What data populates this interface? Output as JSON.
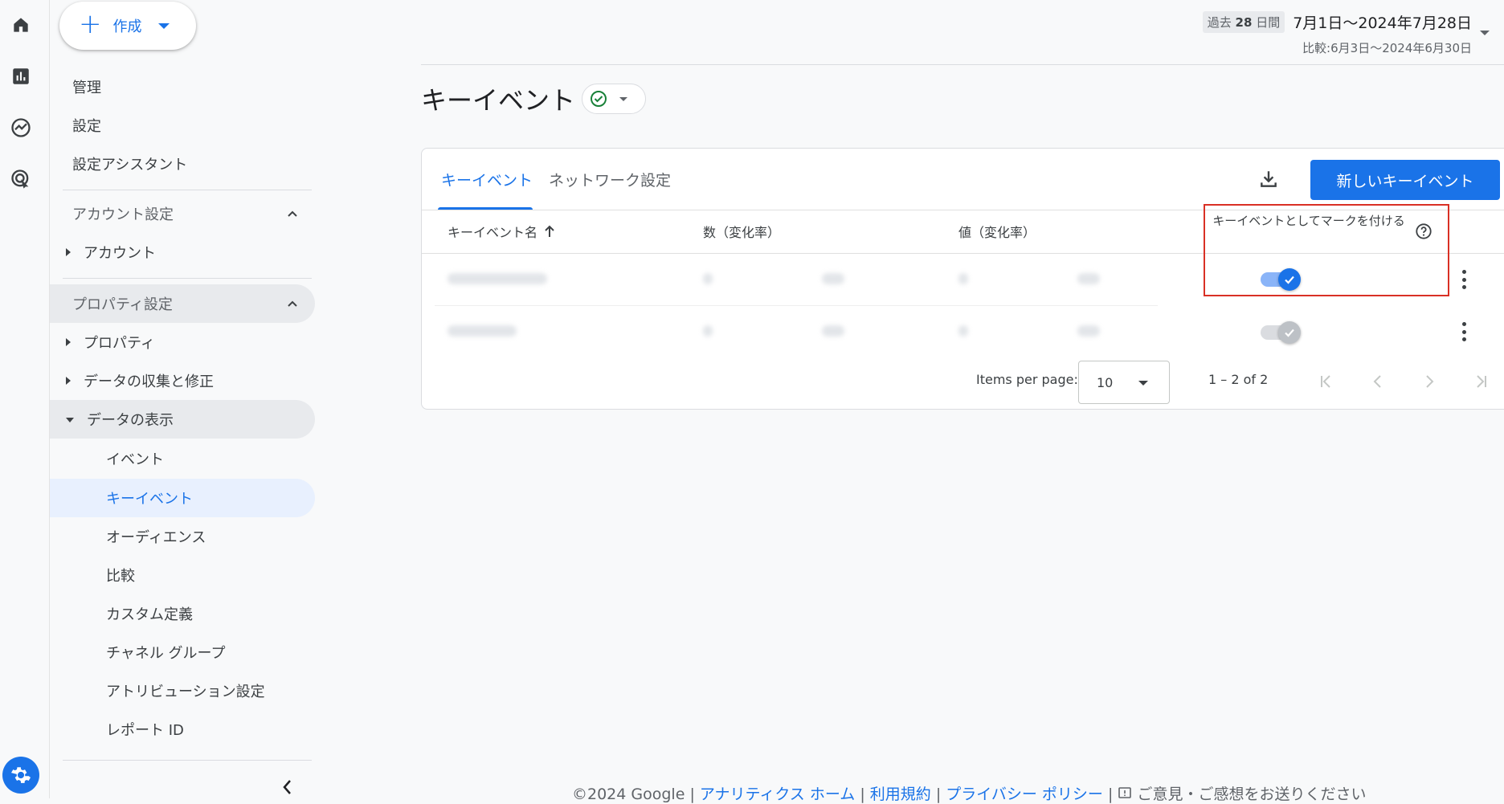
{
  "create_label": "作成",
  "nav": {
    "admin": "管理",
    "settings": "設定",
    "setup_assistant": "設定アシスタント",
    "account_settings": "アカウント設定",
    "account": "アカウント",
    "property_settings": "プロパティ設定",
    "property": "プロパティ",
    "data_collection": "データの収集と修正",
    "data_display": "データの表示",
    "events": "イベント",
    "key_events": "キーイベント",
    "audiences": "オーディエンス",
    "comparisons": "比較",
    "custom_definitions": "カスタム定義",
    "channel_groups": "チャネル グループ",
    "attribution_settings": "アトリビューション設定",
    "report_id": "レポート ID"
  },
  "date": {
    "chip_prefix": "過去",
    "chip_days": "28",
    "chip_suffix": "日間",
    "range": "7月1日～2024年7月28日",
    "compare": "比較:6月3日～2024年6月30日"
  },
  "page_title": "キーイベント",
  "tabs": [
    "キーイベント",
    "ネットワーク設定"
  ],
  "new_event_button": "新しいキーイベント",
  "table": {
    "col_name": "キーイベント名",
    "col_count": "数（変化率）",
    "col_value": "値（変化率）",
    "col_mark": "キーイベントとしてマークを付ける"
  },
  "rows": [
    {
      "enabled": true
    },
    {
      "enabled": true,
      "disabled": true
    }
  ],
  "pager": {
    "items_per_page_label": "Items per page:",
    "page_size": "10",
    "range": "1 – 2 of 2"
  },
  "footer": {
    "copyright": "©2024 Google",
    "sep": " | ",
    "analytics_home": "アナリティクス ホーム",
    "terms": "利用規約",
    "privacy": "プライバシー ポリシー",
    "feedback": "ご意見・ご感想をお送りください"
  },
  "colors": {
    "accent": "#1a73e8",
    "highlight": "#d93025"
  }
}
